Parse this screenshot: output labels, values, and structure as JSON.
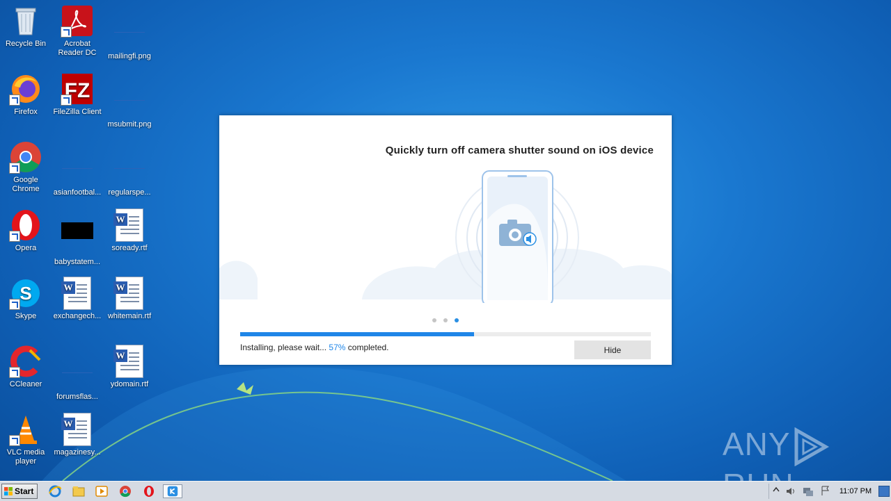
{
  "desktop": {
    "icons": [
      {
        "label": "Recycle Bin"
      },
      {
        "label": "Acrobat Reader DC"
      },
      {
        "label": "mailingfi.png"
      },
      {
        "label": "Firefox"
      },
      {
        "label": "FileZilla Client"
      },
      {
        "label": "msubmit.png"
      },
      {
        "label": "Google Chrome"
      },
      {
        "label": "asianfootbal..."
      },
      {
        "label": "regularspe..."
      },
      {
        "label": "Opera"
      },
      {
        "label": "babystatem..."
      },
      {
        "label": "soready.rtf"
      },
      {
        "label": "Skype"
      },
      {
        "label": "exchangech..."
      },
      {
        "label": "whitemain.rtf"
      },
      {
        "label": "CCleaner"
      },
      {
        "label": "forumsflas..."
      },
      {
        "label": "ydomain.rtf"
      },
      {
        "label": "VLC media player"
      },
      {
        "label": "magazinesy..."
      }
    ]
  },
  "installer": {
    "headline": "Quickly turn off camera shutter sound on iOS device",
    "slide_count": 3,
    "active_slide": 3,
    "progress_fraction": 0.57,
    "status_prefix": "Installing, please wait...",
    "status_percent": "57%",
    "status_suffix": "completed.",
    "hide_label": "Hide"
  },
  "watermark": {
    "left": "ANY",
    "right": "RUN"
  },
  "taskbar": {
    "start_label": "Start",
    "pinned": [
      "ie-icon",
      "explorer-icon",
      "media-player-icon",
      "chrome-icon",
      "opera-icon",
      "installer-icon"
    ],
    "clock": "11:07 PM"
  },
  "colors": {
    "accent": "#1f86e8",
    "desktop_bg": "#1a78d0"
  }
}
